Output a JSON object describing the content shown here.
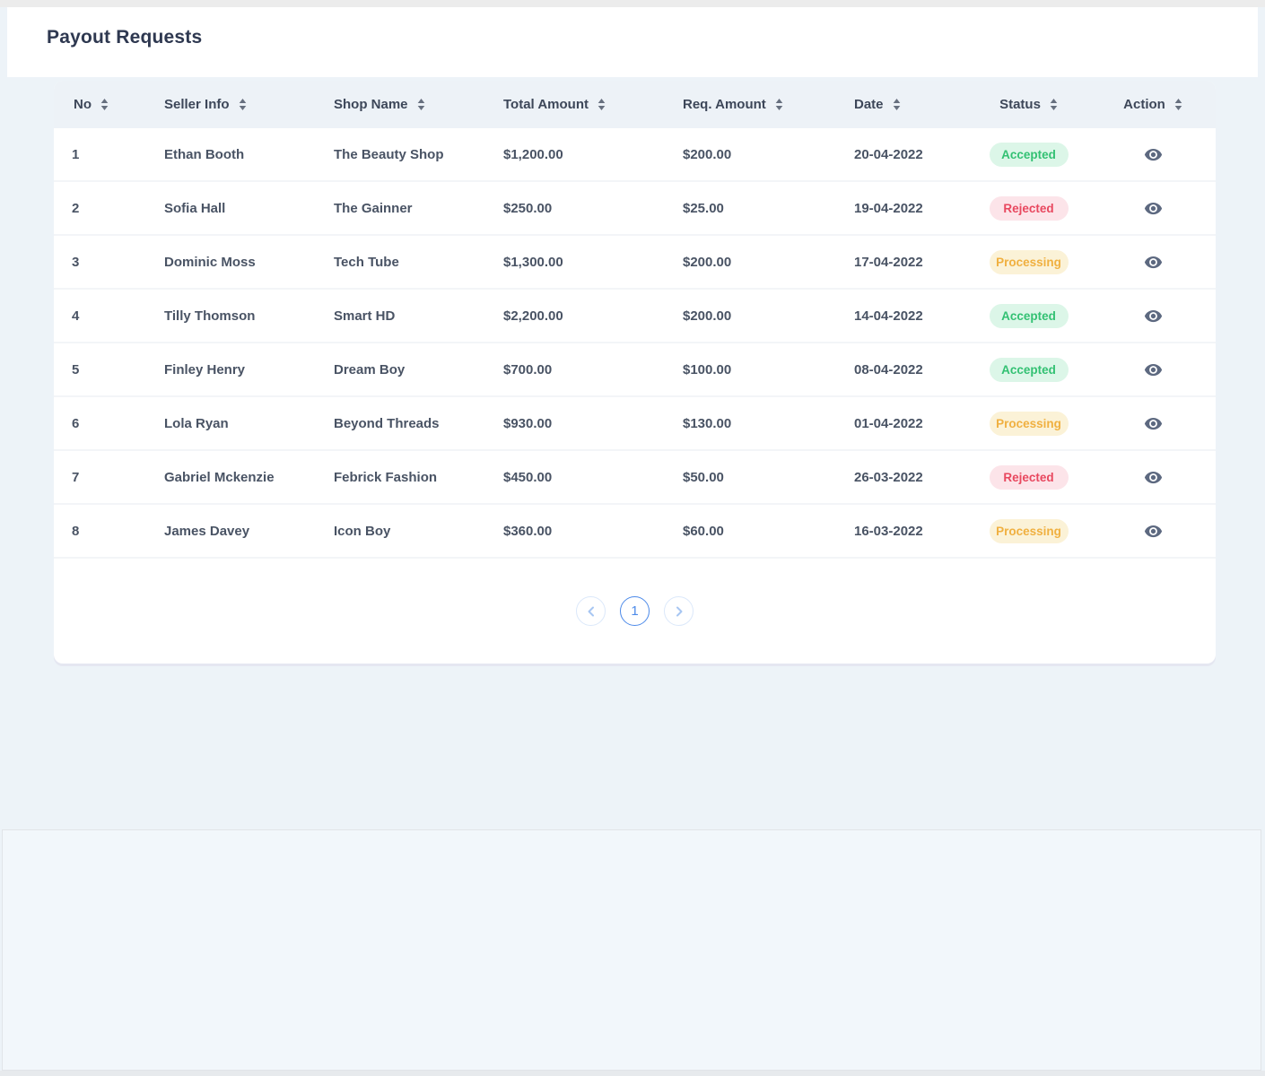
{
  "page_title": "Payout Requests",
  "table": {
    "columns": [
      {
        "key": "no",
        "label": "No"
      },
      {
        "key": "seller",
        "label": "Seller Info"
      },
      {
        "key": "shop",
        "label": "Shop Name"
      },
      {
        "key": "total",
        "label": "Total Amount"
      },
      {
        "key": "req",
        "label": "Req. Amount"
      },
      {
        "key": "date",
        "label": "Date"
      },
      {
        "key": "status",
        "label": "Status",
        "align": "center"
      },
      {
        "key": "action",
        "label": "Action",
        "align": "center"
      }
    ],
    "rows": [
      {
        "no": "1",
        "seller": "Ethan Booth",
        "shop": "The Beauty Shop",
        "total": "$1,200.00",
        "req": "$200.00",
        "date": "20-04-2022",
        "status": "Accepted"
      },
      {
        "no": "2",
        "seller": "Sofia Hall",
        "shop": "The Gainner",
        "total": "$250.00",
        "req": "$25.00",
        "date": "19-04-2022",
        "status": "Rejected"
      },
      {
        "no": "3",
        "seller": "Dominic Moss",
        "shop": "Tech Tube",
        "total": "$1,300.00",
        "req": "$200.00",
        "date": "17-04-2022",
        "status": "Processing"
      },
      {
        "no": "4",
        "seller": "Tilly Thomson",
        "shop": "Smart HD",
        "total": "$2,200.00",
        "req": "$200.00",
        "date": "14-04-2022",
        "status": "Accepted"
      },
      {
        "no": "5",
        "seller": "Finley Henry",
        "shop": "Dream Boy",
        "total": "$700.00",
        "req": "$100.00",
        "date": "08-04-2022",
        "status": "Accepted"
      },
      {
        "no": "6",
        "seller": "Lola Ryan",
        "shop": "Beyond Threads",
        "total": "$930.00",
        "req": "$130.00",
        "date": "01-04-2022",
        "status": "Processing"
      },
      {
        "no": "7",
        "seller": "Gabriel Mckenzie",
        "shop": "Febrick Fashion",
        "total": "$450.00",
        "req": "$50.00",
        "date": "26-03-2022",
        "status": "Rejected"
      },
      {
        "no": "8",
        "seller": "James Davey",
        "shop": "Icon Boy",
        "total": "$360.00",
        "req": "$60.00",
        "date": "16-03-2022",
        "status": "Processing"
      }
    ]
  },
  "status_colors": {
    "Accepted": {
      "text": "#33c173",
      "bg": "#dcf6e8"
    },
    "Rejected": {
      "text": "#e8485f",
      "bg": "#fce4e9"
    },
    "Processing": {
      "text": "#f0b040",
      "bg": "#fbf2d7"
    }
  },
  "icons": {
    "sort": "sort-arrows-icon",
    "action": "eye-icon",
    "prev": "chevron-left-icon",
    "next": "chevron-right-icon"
  },
  "pagination": {
    "current_page": "1"
  },
  "colors": {
    "page_bg": "#edf3f8",
    "card_bg": "#ffffff",
    "table_header_bg": "#edf2f7",
    "accent_blue": "#4c8ae9",
    "icon_gray": "#5d6980"
  }
}
